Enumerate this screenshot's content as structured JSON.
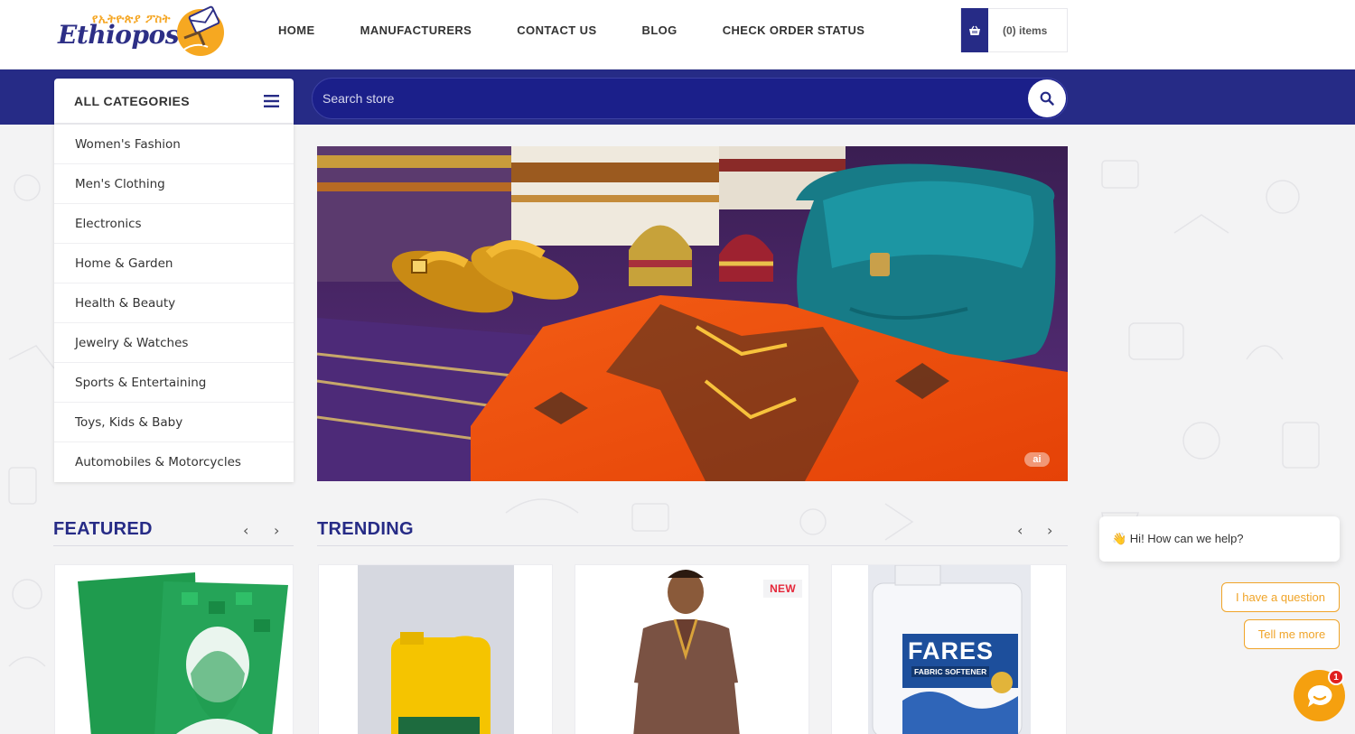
{
  "header": {
    "logo_amharic": "የኢትዮጵያ ፖስት",
    "logo_text": "Ethiopost",
    "nav": [
      "HOME",
      "MANUFACTURERS",
      "CONTACT US",
      "BLOG",
      "CHECK ORDER STATUS"
    ],
    "cart_label": "(0) items"
  },
  "search": {
    "placeholder": "Search store"
  },
  "categories": {
    "title": "ALL CATEGORIES",
    "items": [
      "Women's Fashion",
      "Men's Clothing",
      "Electronics",
      "Home & Garden",
      "Health & Beauty",
      "Jewelry & Watches",
      "Sports & Entertaining",
      "Toys, Kids & Baby",
      "Automobiles & Motorcycles"
    ]
  },
  "hero": {
    "badge": "ai"
  },
  "sections": {
    "featured": "FEATURED",
    "trending": "TRENDING"
  },
  "trending": {
    "new_badge": "NEW",
    "product_brand": "FARES",
    "product_sub": "FABRIC SOFTENER"
  },
  "chat": {
    "greeting": "👋 Hi! How can we help?",
    "option1": "I have a question",
    "option2": "Tell me more",
    "count": "1"
  },
  "colors": {
    "brand_blue": "#262b86",
    "accent_orange": "#f5a00f",
    "badge_red": "#e5273a"
  },
  "icons": [
    "basket-icon",
    "search-icon",
    "hamburger-icon",
    "chevron-left-icon",
    "chevron-right-icon",
    "chat-icon"
  ]
}
